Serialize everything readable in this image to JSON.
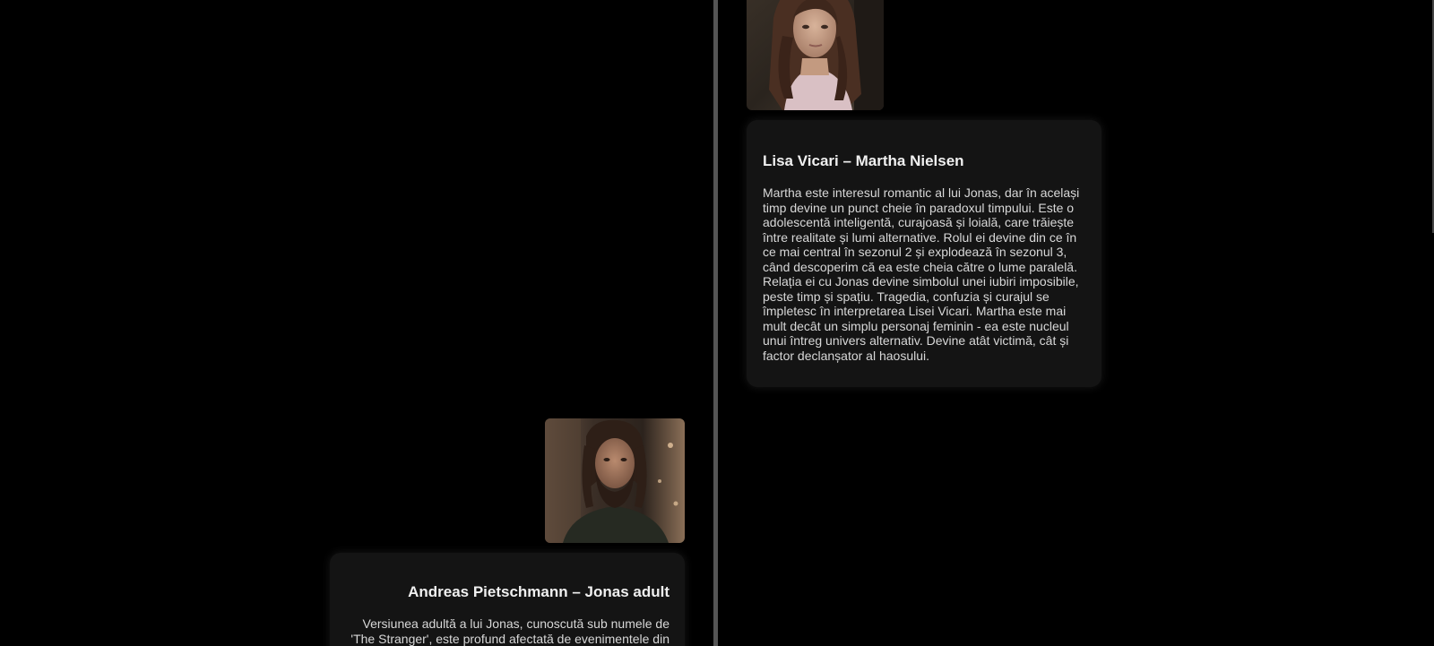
{
  "timeline": {
    "line_color": "#555555",
    "background": "#000000"
  },
  "cards": {
    "martha": {
      "image_alt": "Lisa Vicari – Martha Nielsen",
      "title": "Lisa Vicari – Martha Nielsen",
      "description": "Martha este interesul romantic al lui Jonas, dar în același timp devine un punct cheie în paradoxul timpului. Este o adolescentă inteligentă, curajoasă și loială, care trăiește între realitate și lumi alternative. Rolul ei devine din ce în ce mai central în sezonul 2 și explodează în sezonul 3, când descoperim că ea este cheia către o lume paralelă. Relația ei cu Jonas devine simbolul unei iubiri imposibile, peste timp și spațiu. Tragedia, confuzia și curajul se împletesc în interpretarea Lisei Vicari. Martha este mai mult decât un simplu personaj feminin - ea este nucleul unui întreg univers alternativ. Devine atât victimă, cât și factor declanșator al haosului."
    },
    "jonas_adult": {
      "image_alt": "Andreas Pietschmann – Jonas adult",
      "title": "Andreas Pietschmann – Jonas adult",
      "description": "Versiunea adultă a lui Jonas, cunoscută sub numele de 'The Stranger', este profund afectată de evenimentele din"
    }
  }
}
